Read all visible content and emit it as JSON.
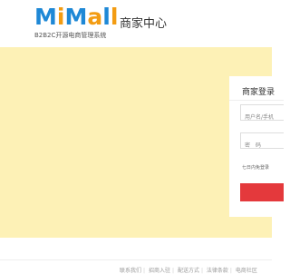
{
  "header": {
    "logo_text": "MiMall",
    "logo_subtitle": "B2B2C开源电商管理系统",
    "title": "商家中心"
  },
  "login": {
    "title": "商家登录",
    "username_placeholder": "用户名/手机",
    "password_placeholder": "密　码",
    "remember_label": "七日内免登录",
    "login_button_label": ""
  },
  "footer": {
    "links": [
      "联系我们",
      "招商入驻",
      "配送方式",
      "法律条款",
      "电商社区"
    ]
  },
  "colors": {
    "banner": "#fdf1b6",
    "accent": "#e4393c",
    "logo_blue": "#1e88d6",
    "logo_orange": "#f39c12"
  }
}
